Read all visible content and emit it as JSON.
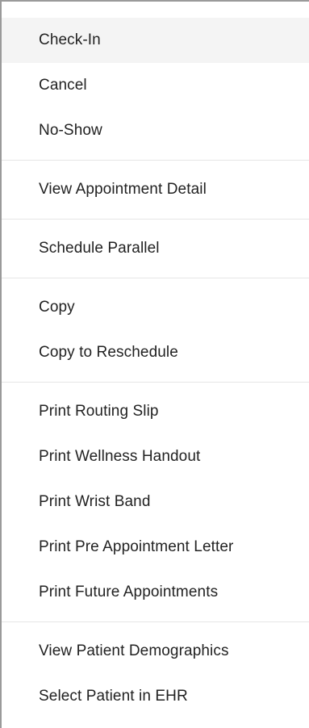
{
  "menu": {
    "groups": [
      {
        "items": [
          "Check-In",
          "Cancel",
          "No-Show"
        ]
      },
      {
        "items": [
          "View Appointment Detail"
        ]
      },
      {
        "items": [
          "Schedule Parallel"
        ]
      },
      {
        "items": [
          "Copy",
          "Copy to Reschedule"
        ]
      },
      {
        "items": [
          "Print Routing Slip",
          "Print Wellness Handout",
          "Print Wrist Band",
          "Print Pre Appointment Letter",
          "Print Future Appointments"
        ]
      },
      {
        "items": [
          "View Patient Demographics",
          "Select Patient in EHR"
        ]
      }
    ]
  },
  "colors": {
    "hover_background": "#f4f4f4",
    "text": "#222222",
    "divider": "#e6e6e6",
    "border": "#9a9a9a"
  }
}
